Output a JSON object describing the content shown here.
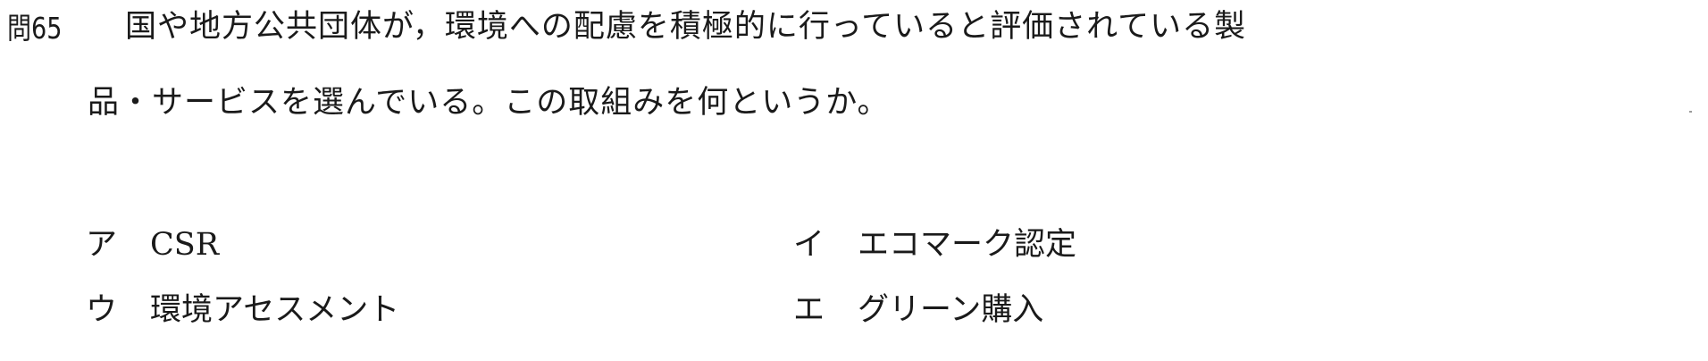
{
  "question": {
    "number": "問65",
    "line1": "国や地方公共団体が，環境への配慮を積極的に行っていると評価されている製",
    "line2": "品・サービスを選んでいる。この取組みを何というか。"
  },
  "choices": [
    {
      "mark": "ア",
      "text": "CSR"
    },
    {
      "mark": "イ",
      "text": "エコマーク認定"
    },
    {
      "mark": "ウ",
      "text": "環境アセスメント"
    },
    {
      "mark": "エ",
      "text": "グリーン購入"
    }
  ]
}
